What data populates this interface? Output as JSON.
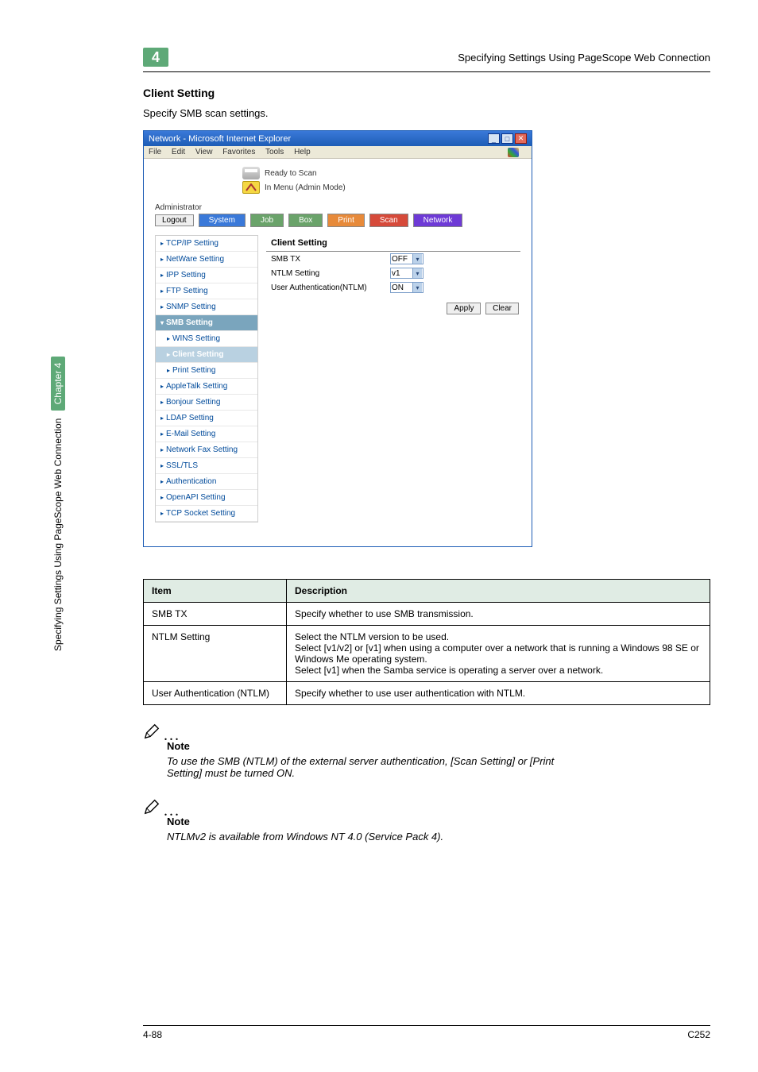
{
  "header": {
    "chapter_badge": "4",
    "title": "Specifying Settings Using PageScope Web Connection"
  },
  "side": {
    "running": "Specifying Settings Using PageScope Web Connection",
    "chapter": "Chapter 4"
  },
  "section": {
    "heading": "Client Setting",
    "intro": "Specify SMB scan settings."
  },
  "browser": {
    "title": "Network - Microsoft Internet Explorer",
    "menu": {
      "file": "File",
      "edit": "Edit",
      "view": "View",
      "favorites": "Favorites",
      "tools": "Tools",
      "help": "Help"
    },
    "status1": "Ready to Scan",
    "status2": "In Menu (Admin Mode)",
    "admin_label": "Administrator",
    "logout": "Logout",
    "tabs": {
      "system": "System",
      "job": "Job",
      "box": "Box",
      "print": "Print",
      "scan": "Scan",
      "network": "Network"
    },
    "sidebar": [
      "TCP/IP Setting",
      "NetWare Setting",
      "IPP Setting",
      "FTP Setting",
      "SNMP Setting",
      "SMB Setting",
      "WINS Setting",
      "Client Setting",
      "Print Setting",
      "AppleTalk Setting",
      "Bonjour Setting",
      "LDAP Setting",
      "E-Mail Setting",
      "Network Fax Setting",
      "SSL/TLS",
      "Authentication",
      "OpenAPI Setting",
      "TCP Socket Setting"
    ],
    "panel": {
      "title": "Client Setting",
      "rows": [
        {
          "label": "SMB TX",
          "value": "OFF"
        },
        {
          "label": "NTLM Setting",
          "value": "v1"
        },
        {
          "label": "User Authentication(NTLM)",
          "value": "ON"
        }
      ],
      "apply": "Apply",
      "clear": "Clear"
    }
  },
  "table": {
    "h1": "Item",
    "h2": "Description",
    "rows": [
      {
        "item": "SMB TX",
        "desc": "Specify whether to use SMB transmission."
      },
      {
        "item": "NTLM Setting",
        "desc": "Select the NTLM version to be used.\nSelect [v1/v2] or [v1] when using a computer over a network that is running a Windows 98 SE or Windows Me operating system.\nSelect [v1] when the Samba service is operating a server over a network."
      },
      {
        "item": "User Authentication (NTLM)",
        "desc": "Specify whether to use user authentication with NTLM."
      }
    ]
  },
  "notes": [
    {
      "heading": "Note",
      "body": "To use the SMB (NTLM) of the external server authentication, [Scan Setting] or [Print Setting] must be turned ON."
    },
    {
      "heading": "Note",
      "body": "NTLMv2 is available from Windows NT 4.0 (Service Pack 4)."
    }
  ],
  "footer": {
    "page": "4-88",
    "model": "C252"
  }
}
